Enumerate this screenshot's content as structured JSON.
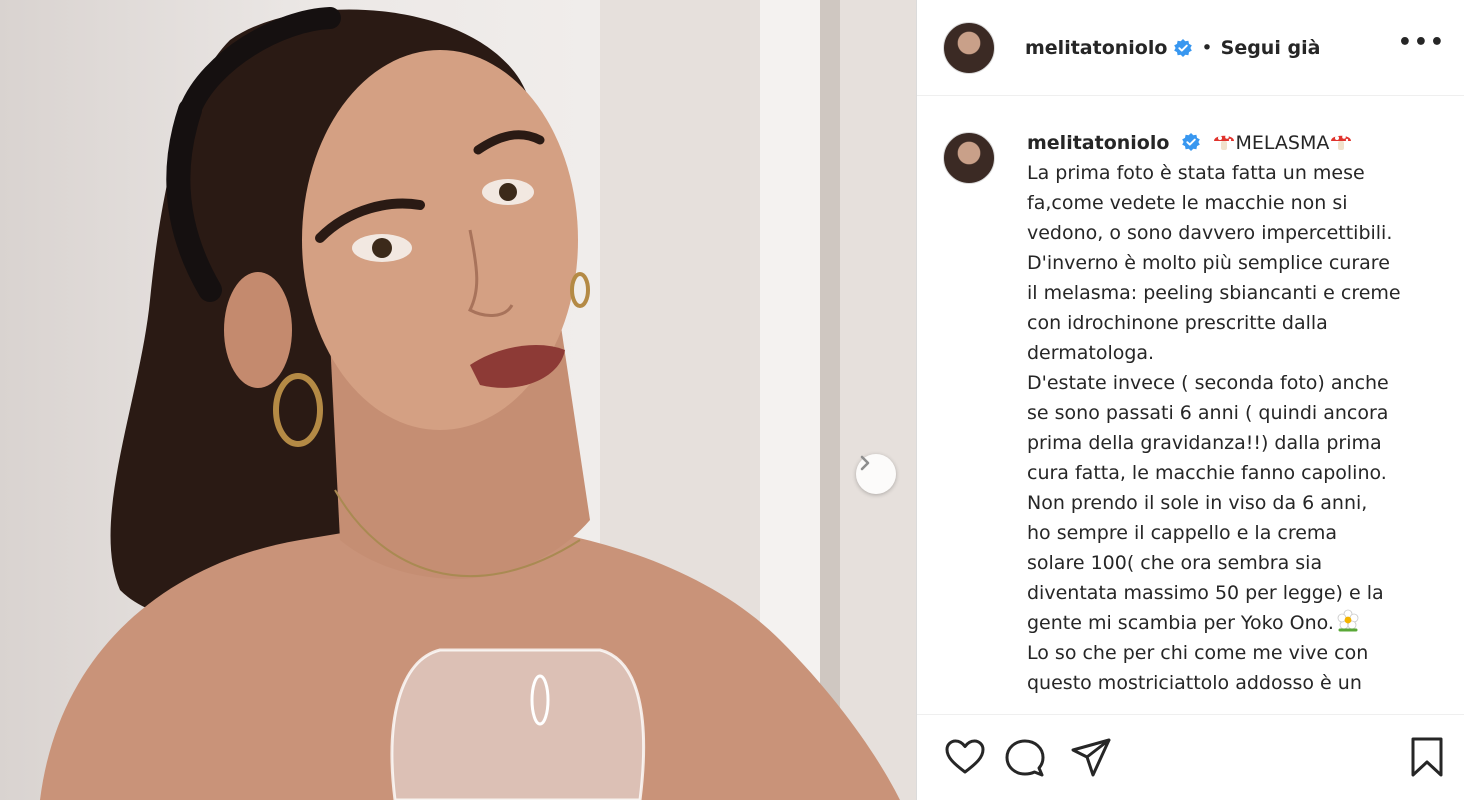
{
  "header": {
    "username": "melitatoniolo",
    "separator": "•",
    "follow_status": "Segui già",
    "more": "•••"
  },
  "caption": {
    "username": "melitatoniolo",
    "title": "MELASMA",
    "lines": [
      "La prima foto è stata fatta un mese",
      "fa,come vedete le macchie non si",
      "vedono, o sono davvero impercettibili.",
      "D'inverno è molto più semplice curare",
      "il melasma: peeling sbiancanti e creme",
      "con idrochinone prescritte dalla",
      "dermatologa.",
      "D'estate invece ( seconda foto) anche",
      "se sono passati 6 anni ( quindi ancora",
      "prima della gravidanza!!) dalla prima",
      "cura fatta, le macchie fanno capolino.",
      "Non prendo il sole in viso da 6 anni,",
      "ho sempre il cappello e la crema",
      "solare 100( che ora sembra sia",
      "diventata massimo 50 per legge) e la",
      "gente mi scambia per Yoko Ono.",
      "Lo so che per chi come me vive con",
      "questo mostriciattolo addosso è un"
    ]
  },
  "icons": {
    "verified": "verified-badge-icon",
    "mushroom": "mushroom-emoji-icon",
    "flower": "flower-emoji-icon",
    "next": "chevron-right-icon",
    "like": "heart-icon",
    "comment": "comment-icon",
    "share": "paper-plane-icon",
    "save": "bookmark-icon"
  },
  "colors": {
    "verified": "#3897f0",
    "text": "#262626",
    "border": "#dbdbdb"
  }
}
